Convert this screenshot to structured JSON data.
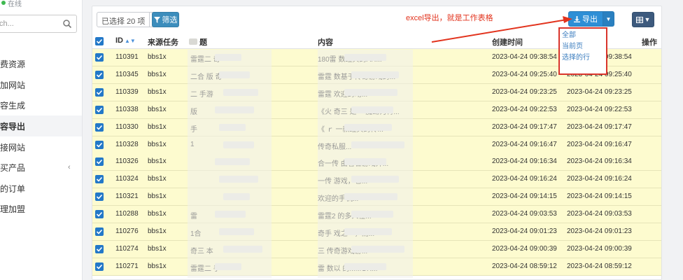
{
  "sidebar": {
    "status": "在线",
    "search_placeholder": "ch...",
    "items": [
      {
        "label": "费资源"
      },
      {
        "label": "加网站"
      },
      {
        "label": "容生成"
      },
      {
        "label": "容导出"
      },
      {
        "label": "接网站"
      },
      {
        "label": "买产品"
      },
      {
        "label": "的订单"
      },
      {
        "label": "理加盟"
      }
    ]
  },
  "toolbar": {
    "selected_label": "已选择 20 项",
    "filter_label": "筛选",
    "export_label": "导出",
    "annotation": "excel导出，就是工作表格"
  },
  "export_menu": {
    "items": [
      "全部",
      "当前页",
      "选择的行"
    ]
  },
  "table": {
    "headers": {
      "id": "ID",
      "source": "来源任务",
      "title": "题",
      "content": "内容",
      "created": "创建时间",
      "action": "操作"
    },
    "rows": [
      {
        "id": "110391",
        "source": "bbs1x",
        "title": "雷霆二   奇",
        "content": "180雷                数经典的AR...",
        "created": "2023-04-24 09:38:54",
        "updated": "2023-04-24 09:38:54"
      },
      {
        "id": "110345",
        "source": "bbs1x",
        "title": "二合    版   奇",
        "content": "雷霆      数基于传奇游戏的...",
        "created": "2023-04-24 09:25:40",
        "updated": "2023-04-24 09:25:40"
      },
      {
        "id": "110339",
        "source": "bbs1x",
        "title": "二    手游",
        "content": "雷霆            欢迎的动...",
        "created": "2023-04-24 09:23:25",
        "updated": "2023-04-24 09:23:25"
      },
      {
        "id": "110338",
        "source": "bbs1x",
        "title": "版",
        "content": "《火   奇三              是一   魔幻为背...",
        "created": "2023-04-24 09:22:53",
        "updated": "2023-04-24 09:22:53"
      },
      {
        "id": "110330",
        "source": "bbs1x",
        "title": "手",
        "content": "《  ｒ                  一款经典的传...",
        "created": "2023-04-24 09:17:47",
        "updated": "2023-04-24 09:17:47"
      },
      {
        "id": "110328",
        "source": "bbs1x",
        "title": "1",
        "content": "              传奇私服...",
        "created": "2023-04-24 09:16:47",
        "updated": "2023-04-24 09:16:47"
      },
      {
        "id": "110326",
        "source": "bbs1x",
        "title": "",
        "content": "合一传          由著名游戏开...",
        "created": "2023-04-24 09:16:34",
        "updated": "2023-04-24 09:16:34"
      },
      {
        "id": "110324",
        "source": "bbs1x",
        "title": "",
        "content": "一传              游戏，它...",
        "created": "2023-04-24 09:16:24",
        "updated": "2023-04-24 09:16:24"
      },
      {
        "id": "110321",
        "source": "bbs1x",
        "title": "",
        "content": "               欢迎的手机...",
        "created": "2023-04-24 09:14:15",
        "updated": "2023-04-24 09:14:15"
      },
      {
        "id": "110288",
        "source": "bbs1x",
        "title": "雷",
        "content": "雷霆2          的多人在...",
        "created": "2023-04-24 09:03:53",
        "updated": "2023-04-24 09:03:53"
      },
      {
        "id": "110276",
        "source": "bbs1x",
        "title": "1合",
        "content": "奇手          戏之一，而...",
        "created": "2023-04-24 09:01:23",
        "updated": "2023-04-24 09:01:23"
      },
      {
        "id": "110274",
        "source": "bbs1x",
        "title": "奇三         本",
        "content": "三            传奇游戏游...",
        "created": "2023-04-24 09:00:39",
        "updated": "2023-04-24 09:00:39"
      },
      {
        "id": "110271",
        "source": "bbs1x",
        "title": "雷霆二      手",
        "content": "雷              数以   的MMOR...",
        "created": "2023-04-24 08:59:12",
        "updated": "2023-04-24 08:59:12"
      }
    ]
  }
}
